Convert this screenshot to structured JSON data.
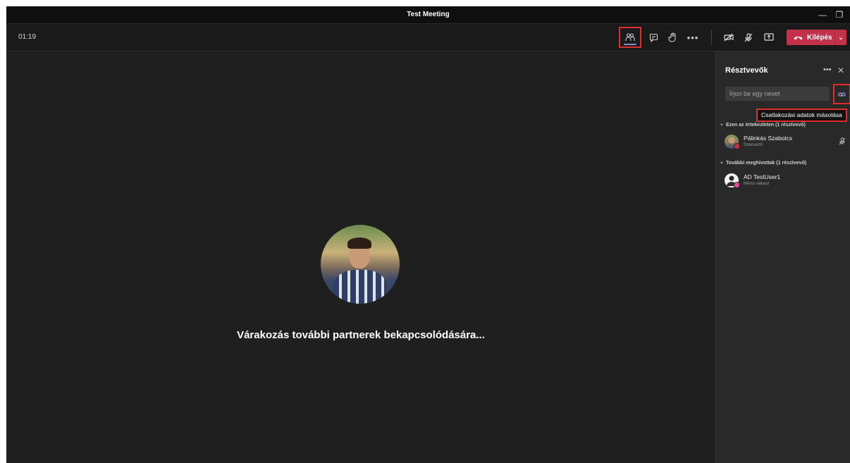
{
  "window": {
    "title": "Test Meeting",
    "controls": {
      "minimize": "—",
      "restore": "❐",
      "close": "×"
    }
  },
  "toolbar": {
    "timer": "01:19",
    "icons": [
      "participants-icon",
      "chat-icon",
      "raise-hand-icon",
      "more-icon",
      "camera-off-icon",
      "mic-off-icon",
      "share-screen-icon"
    ],
    "leave_label": "Kilépés"
  },
  "stage": {
    "waiting_text": "Várakozás további partnerek bekapcsolódására..."
  },
  "panel": {
    "title": "Résztvevők",
    "search_placeholder": "Írjon be egy nevet",
    "copy_tooltip": "Csatlakozási adatok másolása",
    "sections": [
      {
        "label": "Ezen az értekezleten (1 résztvevő)",
        "people": [
          {
            "name": "Pálinkás Szabolcs",
            "role": "Szervező",
            "muted": true
          }
        ]
      },
      {
        "label": "További meghívottak (1 résztvevő)",
        "people": [
          {
            "name": "AD TestUser1",
            "role": "Nincs válasz",
            "muted": false
          }
        ]
      }
    ]
  },
  "colors": {
    "leave_button": "#c4314b",
    "accent": "#8b8cc7",
    "highlight_box": "#e02d2d"
  }
}
